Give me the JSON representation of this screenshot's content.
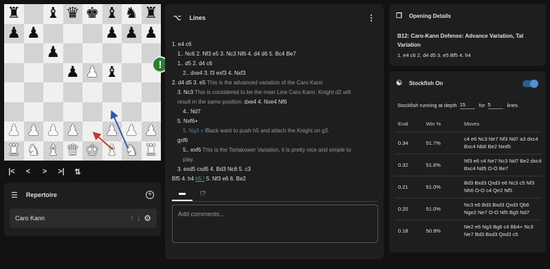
{
  "board": {
    "ranks": [
      [
        "bR",
        "",
        "bB",
        "bQ",
        "bK",
        "bB",
        "bN",
        "bR"
      ],
      [
        "bP",
        "bP",
        "",
        "",
        "",
        "bP",
        "bP",
        "bP"
      ],
      [
        "",
        "",
        "bP",
        "",
        "",
        "",
        "",
        ""
      ],
      [
        "",
        "",
        "",
        "bP",
        "wP",
        "bB",
        "",
        ""
      ],
      [
        "",
        "",
        "",
        "",
        "",
        "",
        "",
        ""
      ],
      [
        "",
        "",
        "",
        "",
        "",
        "",
        "",
        ""
      ],
      [
        "wP",
        "wP",
        "wP",
        "wP",
        "",
        "wP",
        "wP",
        "wP"
      ],
      [
        "wR",
        "wN",
        "wB",
        "wQ",
        "wK",
        "wB",
        "wN",
        "wR"
      ]
    ],
    "badge": "!"
  },
  "nav": {
    "first": "|<",
    "prev": "<",
    "next": ">",
    "last": ">|",
    "flip": "⇅"
  },
  "repertoire": {
    "title": "Repertoire",
    "items": [
      {
        "name": "Caro Kann"
      }
    ]
  },
  "lines": {
    "title": "Lines",
    "icon": "branch-icon",
    "rows": [
      {
        "indent": 0,
        "parts": [
          {
            "t": "1. e4 c6"
          }
        ]
      },
      {
        "indent": 1,
        "parts": [
          {
            "t": "1.. Nc6 2. Nf3 e5 3. Nc3 Nf6 4. d4 d6 5. Bc4 Be7"
          }
        ]
      },
      {
        "indent": 1,
        "parts": [
          {
            "t": "1.. d5 2. d4 c6"
          }
        ]
      },
      {
        "indent": 2,
        "parts": [
          {
            "t": "2.. dxe4 3. f3 exf3 4. Nxf3"
          }
        ]
      },
      {
        "indent": 0,
        "parts": [
          {
            "t": "2. d4 d5 3. e5  "
          },
          {
            "t": "This is the advanced variation of the Caro Kann",
            "cls": "c"
          }
        ]
      },
      {
        "indent": 1,
        "parts": [
          {
            "t": "3. Nc3  "
          },
          {
            "t": "This is considered to be the main Line Caro Kann. Knight d2 will",
            "cls": "c"
          }
        ]
      },
      {
        "indent": 1,
        "parts": [
          {
            "t": "result in the same position.",
            "cls": "c"
          },
          {
            "t": "  dxe4 4. Nxe4 Nf6"
          }
        ]
      },
      {
        "indent": 2,
        "parts": [
          {
            "t": "4.. Nd7"
          }
        ]
      },
      {
        "indent": 1,
        "parts": [
          {
            "t": "5. Nxf6+"
          }
        ]
      },
      {
        "indent": 2,
        "parts": [
          {
            "t": "5. Ng3 »",
            "cls": "hl"
          },
          {
            "t": "  Black want to push h5 and attach the Knight on g3.",
            "cls": "c"
          }
        ]
      },
      {
        "indent": 1,
        "parts": [
          {
            "t": "gxf6"
          }
        ]
      },
      {
        "indent": 2,
        "parts": [
          {
            "t": "5.. exf6  "
          },
          {
            "t": "This is the Tartakower Variation, it is pretty nice and simple to",
            "cls": "c"
          }
        ]
      },
      {
        "indent": 2,
        "parts": [
          {
            "t": "play.",
            "cls": "c"
          }
        ]
      },
      {
        "indent": 1,
        "parts": [
          {
            "t": "3. exd5 cxd5 4. Bd3 Nc6 5. c3"
          }
        ]
      },
      {
        "indent": 0,
        "parts": [
          {
            "t": "Bf5 4. h4 "
          },
          {
            "t": "h5 !",
            "cls": "gr"
          },
          {
            "t": " 5. Nf3 e6 6. Be2"
          }
        ]
      }
    ],
    "tabs": [
      {
        "label": "▬",
        "name": "tab-comments",
        "active": true
      },
      {
        "label": "!?",
        "name": "tab-annotations",
        "active": false
      }
    ],
    "comment_placeholder": "Add comments..."
  },
  "opening": {
    "title": "Opening Details",
    "name": "B12: Caro-Kann Defense: Advance Variation, Tal Variation",
    "moves": "1. e4 c6 2. d4 d5 3. e5 Bf5 4. h4"
  },
  "stockfish": {
    "title": "Stockfish On",
    "enabled": true,
    "status_prefix": "Stockfish running at depth",
    "depth": "15",
    "for_label": "for",
    "lines_count": "5",
    "lines_label": "lines.",
    "columns": [
      "Eval",
      "Win %",
      "Moves"
    ],
    "rows": [
      {
        "eval": "0.34",
        "win": "51.7%",
        "moves": "c4 e6 Nc3 Ne7 Nf3 Nd7 a3 dxc4 Bxc4 Nb6 Be2 Ned5"
      },
      {
        "eval": "0.32",
        "win": "51.6%",
        "moves": "Nf3 e6 c4 Ne7 Nc3 Nd7 Be2 dxc4 Bxc4 Nd5 O-O Be7"
      },
      {
        "eval": "0.21",
        "win": "51.0%",
        "moves": "Bd3 Bxd3 Qxd3 e6 Nc3 c5 Nf3 Nh6 O-O c4 Qe2 Nf5"
      },
      {
        "eval": "0.20",
        "win": "51.0%",
        "moves": "Nc3 e6 Bd3 Bxd3 Qxd3 Qb6 Nge2 Ne7 O-O Nf5 Bg5 Nd7"
      },
      {
        "eval": "0.18",
        "win": "50.9%",
        "moves": "Ne2 e6 Ng3 Bg6 c4 Bb4+ Nc3 Ne7 Bd3 Bxd3 Qxd3 c5"
      }
    ]
  }
}
